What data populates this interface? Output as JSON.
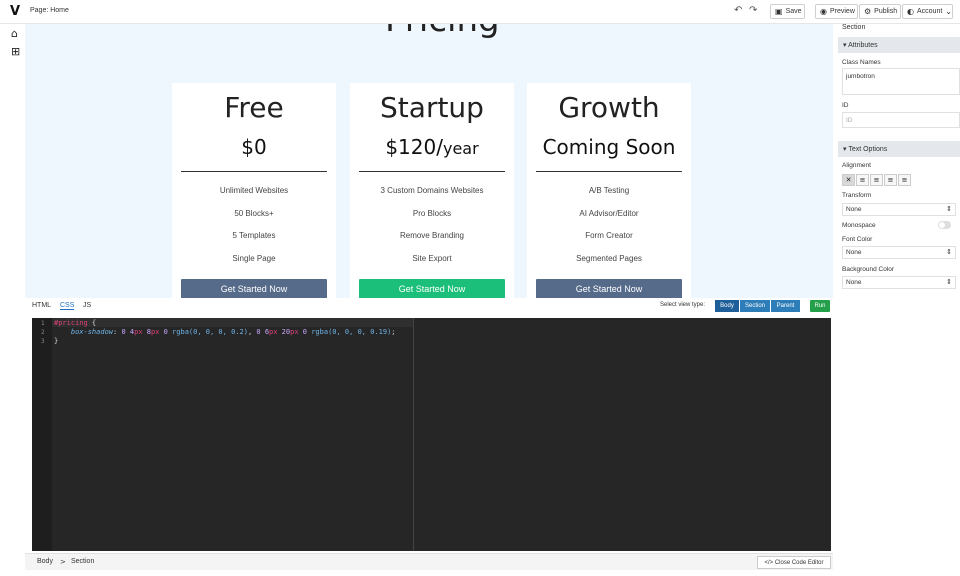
{
  "topbar": {
    "logo": "V",
    "page_label": "Page: Home",
    "undo_icon": "↶",
    "redo_icon": "↷",
    "save_label": "Save",
    "save_icon": "▣",
    "preview_label": "Preview",
    "preview_icon": "◉",
    "publish_label": "Publish",
    "publish_icon": "⚙",
    "account_label": "Account",
    "account_icon": "◐",
    "account_chevron": "⌄"
  },
  "rail": {
    "home_icon": "⌂",
    "add_icon": "⊞"
  },
  "canvas": {
    "heading": "Pricing",
    "cards": [
      {
        "plan": "Free",
        "price": "$0",
        "per": "",
        "features": [
          "Unlimited Websites",
          "50 Blocks+",
          "5 Templates",
          "Single Page"
        ],
        "cta": "Get Started Now",
        "cta_color": "#566a8a"
      },
      {
        "plan": "Startup",
        "price": "$120/",
        "per": "year",
        "features": [
          "3 Custom Domains Websites",
          "Pro Blocks",
          "Remove Branding",
          "Site Export"
        ],
        "cta": "Get Started Now",
        "cta_color": "#1bbf7a"
      },
      {
        "plan": "Growth",
        "price": "Coming Soon",
        "per": "",
        "features": [
          "A/B Testing",
          "AI Advisor/Editor",
          "Form Creator",
          "Segmented Pages"
        ],
        "cta": "Get Started Now",
        "cta_color": "#566a8a"
      }
    ]
  },
  "editor": {
    "tabs": [
      "HTML",
      "CSS",
      "JS"
    ],
    "view_label": "Select view type:",
    "view_types": [
      "Body",
      "Section",
      "Parent"
    ],
    "run_label": "Run",
    "line_numbers": [
      "1",
      "2",
      "3"
    ],
    "code": {
      "l1_selector": "#pricing",
      "l1_brace": " {",
      "l2_indent": "    ",
      "l2_prop": "box-shadow",
      "l2_colon": ": ",
      "l2_v1": "0 ",
      "l2_v2n": "4",
      "l2_v2u": "px",
      "l2_v3n": " 8",
      "l2_v3u": "px",
      "l2_v4": " 0 ",
      "l2_fn1": "rgba(0, 0, 0, 0.2)",
      "l2_comma": ", ",
      "l2_v5": "0 ",
      "l2_v6n": "6",
      "l2_v6u": "px",
      "l2_v7n": " 20",
      "l2_v7u": "px",
      "l2_v8": " 0 ",
      "l2_fn2": "rgba(0, 0, 0, 0.19)",
      "l2_end": ";",
      "l3": "}"
    }
  },
  "breadcrumb": {
    "items": [
      "Body",
      "Section"
    ],
    "separator": ">",
    "close_label": "Close Code Editor",
    "close_icon": "</>"
  },
  "panel": {
    "title": "Section",
    "attributes_label": "▾ Attributes",
    "class_names_label": "Class Names",
    "class_names_value": "jumbotron",
    "id_label": "ID",
    "id_placeholder": "ID",
    "text_options_label": "▾ Text Options",
    "alignment_label": "Alignment",
    "alignment_icons": [
      "✕",
      "≡",
      "≡",
      "≡",
      "≡"
    ],
    "transform_label": "Transform",
    "transform_value": "None",
    "monospace_label": "Monospace",
    "font_color_label": "Font Color",
    "font_color_value": "None",
    "bg_color_label": "Background Color",
    "bg_color_value": "None",
    "select_arrow": "⇕"
  }
}
